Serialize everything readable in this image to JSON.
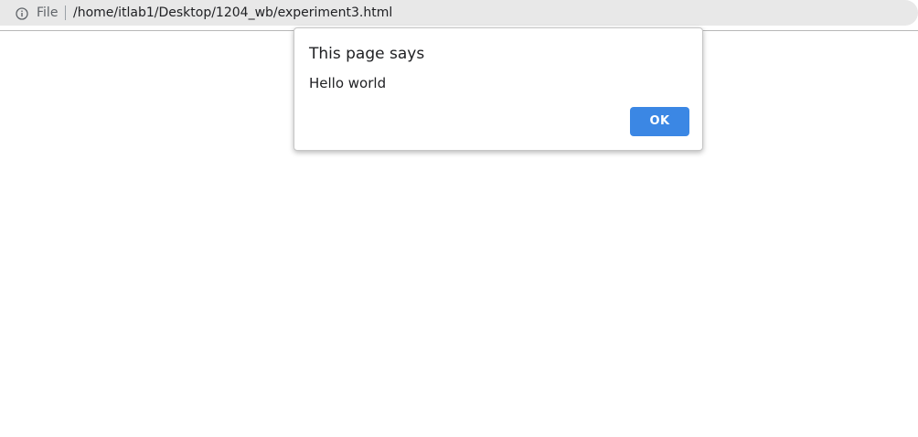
{
  "address_bar": {
    "icon": "info-icon",
    "scheme_label": "File",
    "url": "/home/itlab1/Desktop/1204_wb/experiment3.html"
  },
  "dialog": {
    "title": "This page says",
    "message": "Hello world",
    "ok_label": "OK"
  },
  "colors": {
    "accent": "#3b87e4",
    "address_bar_bg": "#e8e8e8",
    "page_bg": "#ffffff"
  }
}
